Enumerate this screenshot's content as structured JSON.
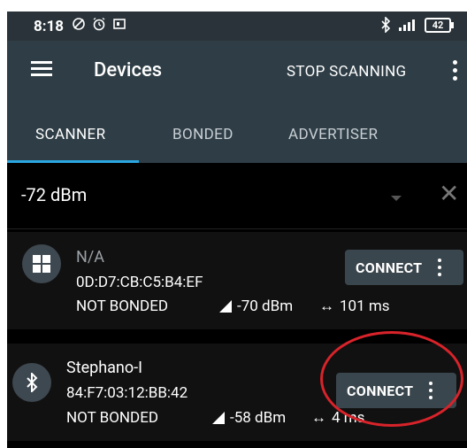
{
  "status_bar": {
    "time": "8:18",
    "icons": [
      "do-not-disturb-icon",
      "alarm-icon",
      "screen-cast-icon"
    ],
    "right_icons": [
      "bluetooth-icon",
      "signal-icon"
    ],
    "battery": "42"
  },
  "app_bar": {
    "title": "Devices",
    "action": "STOP SCANNING"
  },
  "tabs": [
    {
      "label": "SCANNER",
      "active": true
    },
    {
      "label": "BONDED",
      "active": false
    },
    {
      "label": "ADVERTISER",
      "active": false
    }
  ],
  "filter": {
    "value": "-72 dBm",
    "clear": "✕"
  },
  "devices": [
    {
      "name": "N/A",
      "address": "0D:D7:CB:C5:B4:EF",
      "bond_state": "NOT BONDED",
      "rssi": "-70 dBm",
      "interval": "101 ms",
      "icon": "windows-icon",
      "button": "CONNECT"
    },
    {
      "name": "Stephano-I",
      "address": "84:F7:03:12:BB:42",
      "bond_state": "NOT BONDED",
      "rssi": "-58 dBm",
      "interval": "4 ms",
      "icon": "bluetooth-icon",
      "button": "CONNECT"
    }
  ],
  "colors": {
    "app_bar": "#2f3e46",
    "tab_indicator": "#2aa6e0",
    "annotation": "#d8232a"
  }
}
